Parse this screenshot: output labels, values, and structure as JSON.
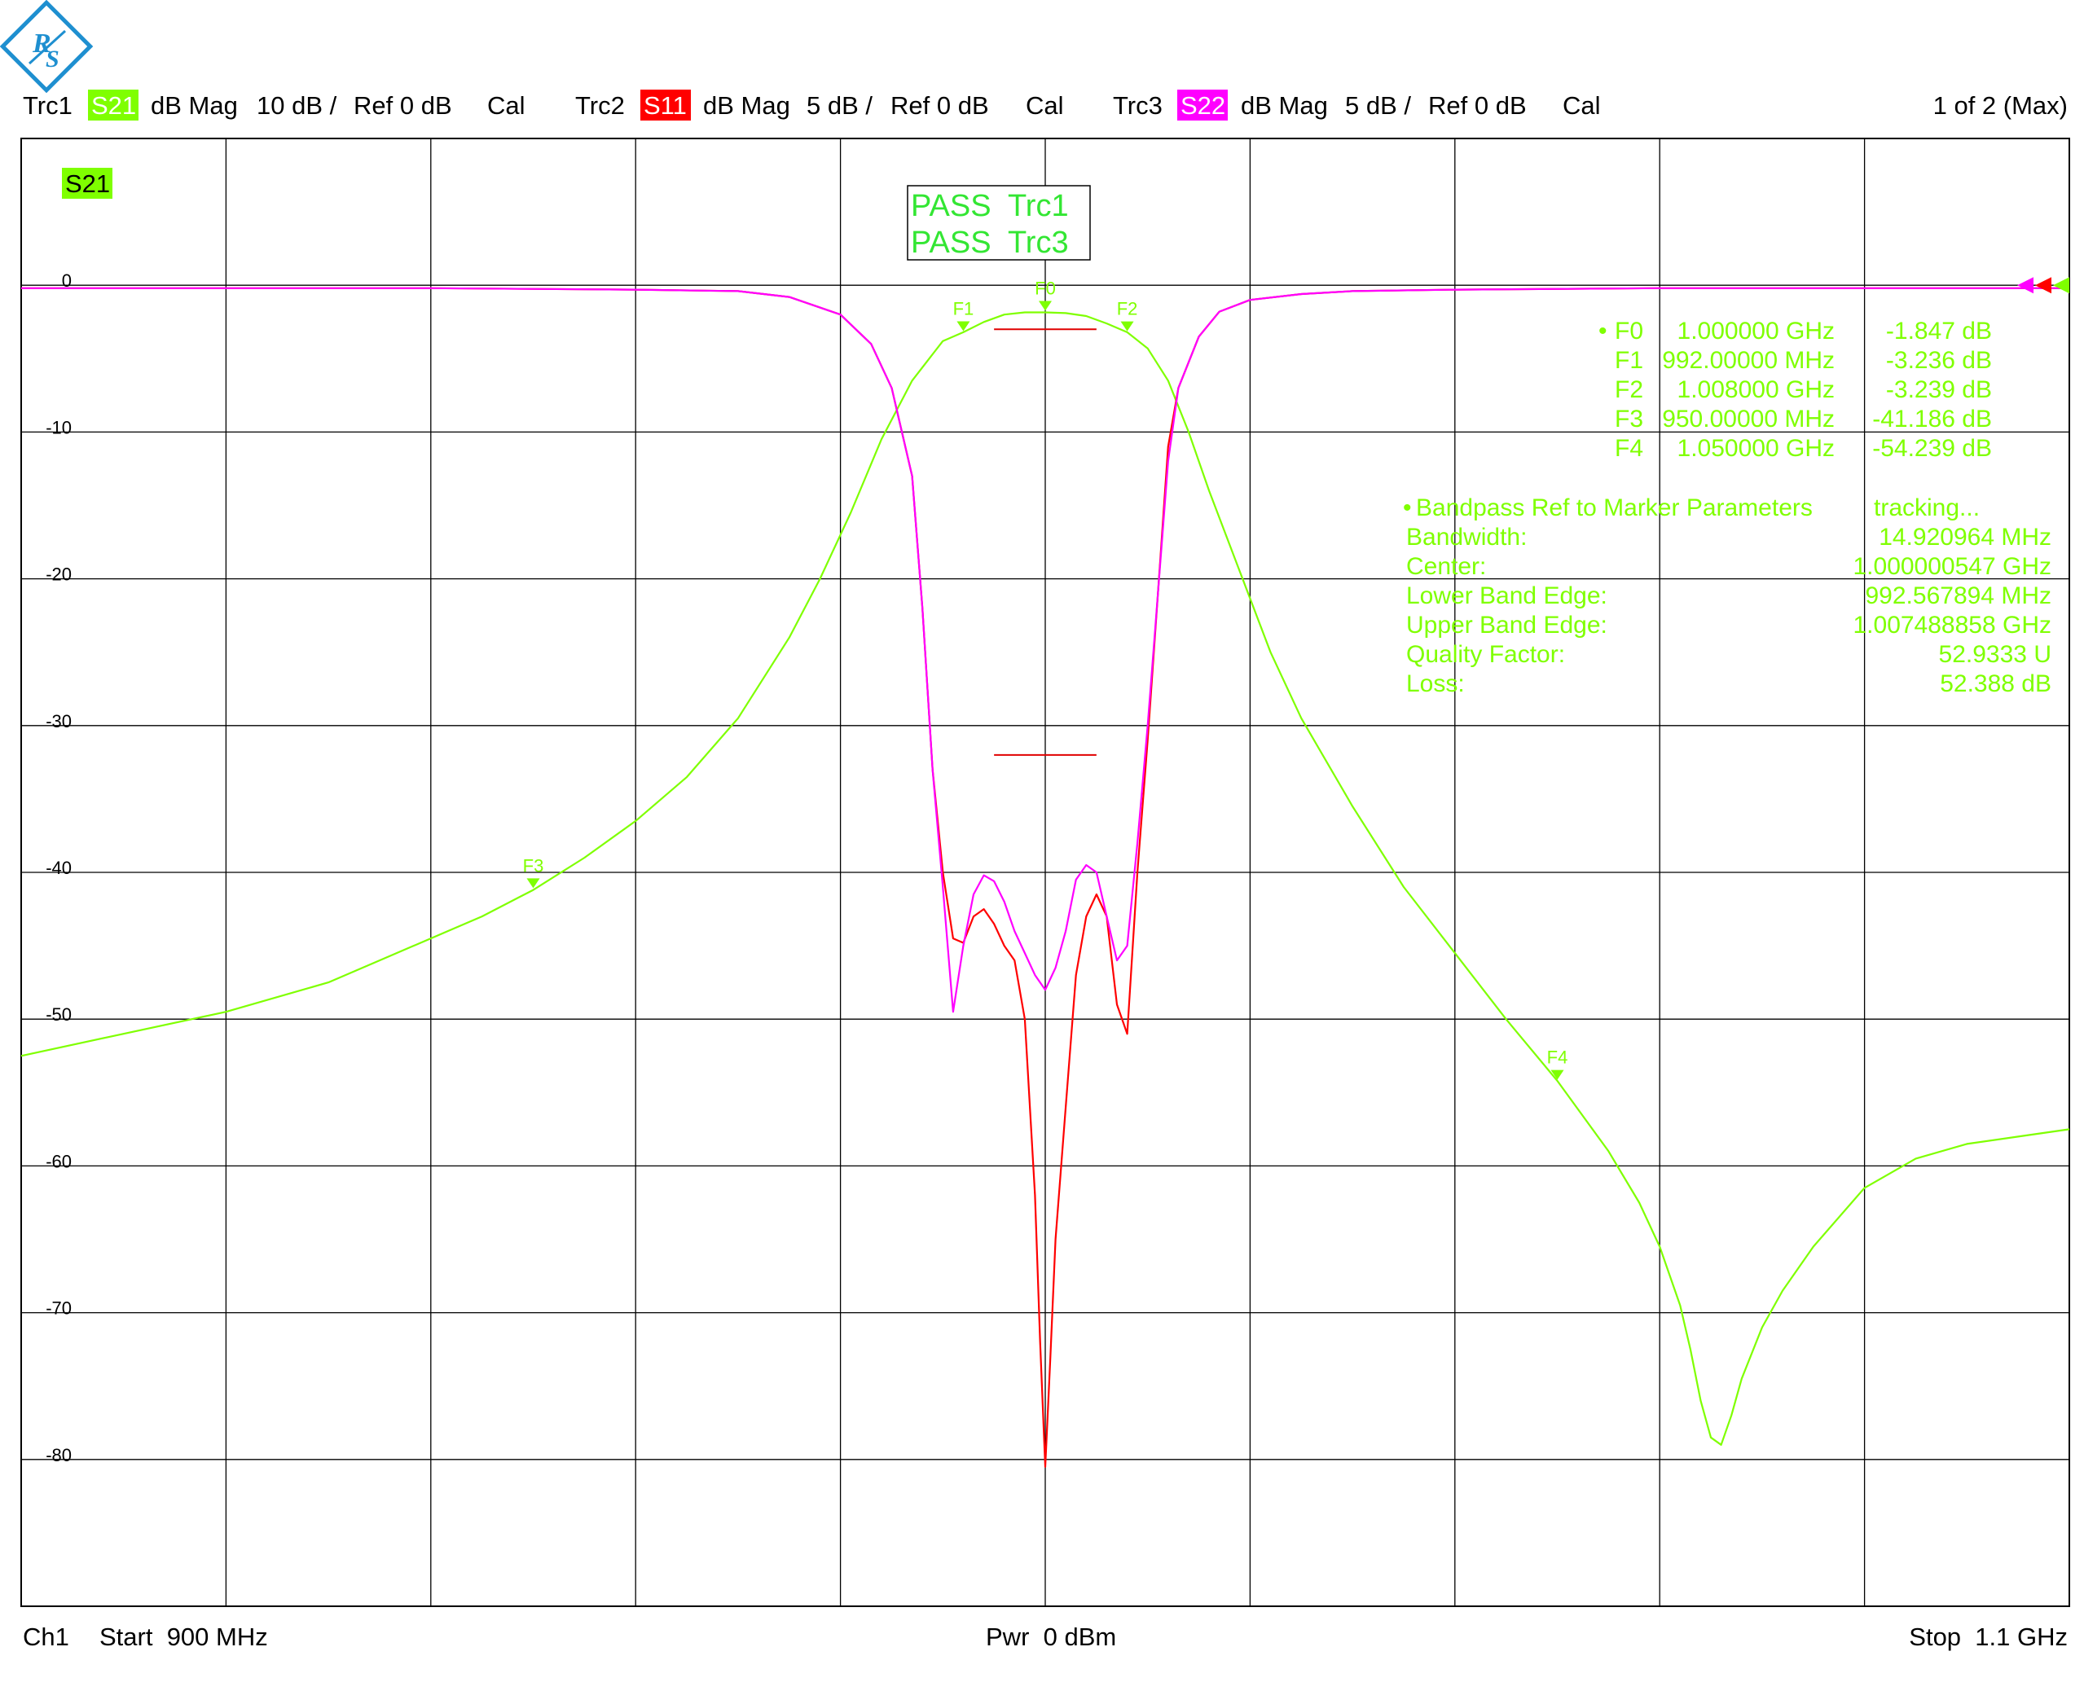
{
  "header": {
    "traces": [
      {
        "id": "Trc1",
        "param": "S21",
        "format": "dB Mag",
        "scale": "10 dB /",
        "ref": "Ref 0 dB",
        "cal": "Cal",
        "color": "#7fff00"
      },
      {
        "id": "Trc2",
        "param": "S11",
        "format": "dB Mag",
        "scale": "5 dB /",
        "ref": "Ref 0 dB",
        "cal": "Cal",
        "color": "#ff0000"
      },
      {
        "id": "Trc3",
        "param": "S22",
        "format": "dB Mag",
        "scale": "5 dB /",
        "ref": "Ref 0 dB",
        "cal": "Cal",
        "color": "#ff00ff"
      }
    ],
    "page_indicator": "1 of 2 (Max)"
  },
  "diagram": {
    "label": "S21",
    "pass": [
      "PASS  Trc1",
      "PASS  Trc3"
    ]
  },
  "marker_table": [
    {
      "name": "F0",
      "freq": "1.000000 GHz",
      "value": "-1.847 dB",
      "active": true
    },
    {
      "name": "F1",
      "freq": "992.00000 MHz",
      "value": "-3.236 dB",
      "active": false
    },
    {
      "name": "F2",
      "freq": "1.008000 GHz",
      "value": "-3.239 dB",
      "active": false
    },
    {
      "name": "F3",
      "freq": "950.00000 MHz",
      "value": "-41.186 dB",
      "active": false
    },
    {
      "name": "F4",
      "freq": "1.050000 GHz",
      "value": "-54.239 dB",
      "active": false
    }
  ],
  "bandpass": {
    "title": "Bandpass Ref to Marker Parameters",
    "status": "tracking...",
    "rows": [
      {
        "label": "Bandwidth:",
        "value": "14.920964 MHz"
      },
      {
        "label": "Center:",
        "value": "1.000000547 GHz"
      },
      {
        "label": "Lower Band Edge:",
        "value": "992.567894 MHz"
      },
      {
        "label": "Upper Band Edge:",
        "value": "1.007488858 GHz"
      },
      {
        "label": "Quality Factor:",
        "value": "52.9333 U"
      },
      {
        "label": "Loss:",
        "value": "52.388 dB"
      }
    ]
  },
  "footer": {
    "channel": "Ch1",
    "start": "Start  900 MHz",
    "power": "Pwr  0 dBm",
    "stop": "Stop  1.1 GHz"
  },
  "chart_data": {
    "type": "line",
    "title": "",
    "xlabel": "",
    "ylabel": "",
    "x_unit": "MHz",
    "xlim": [
      900,
      1100
    ],
    "ylim": [
      -90,
      10
    ],
    "y_tick_labels": [
      "0",
      "-10",
      "-20",
      "-30",
      "-40",
      "-50",
      "-60",
      "-70",
      "-80"
    ],
    "y_tick_values": [
      0,
      -10,
      -20,
      -30,
      -40,
      -50,
      -60,
      -70,
      -80
    ],
    "grid": true,
    "series": [
      {
        "name": "S21",
        "color": "#7fff00",
        "x": [
          900,
          910,
          920,
          930,
          935,
          940,
          945,
          950,
          955,
          960,
          965,
          970,
          975,
          978,
          981,
          984,
          987,
          990,
          992,
          994,
          996,
          998,
          1000,
          1002,
          1004,
          1006,
          1008,
          1010,
          1012,
          1014,
          1016,
          1019,
          1022,
          1025,
          1030,
          1035,
          1040,
          1045,
          1050,
          1055,
          1058,
          1060,
          1062,
          1063,
          1064,
          1065,
          1066,
          1067,
          1068,
          1070,
          1072,
          1075,
          1080,
          1085,
          1090,
          1095,
          1100
        ],
        "y": [
          -52.5,
          -51,
          -49.5,
          -47.5,
          -46,
          -44.5,
          -43,
          -41.2,
          -39,
          -36.5,
          -33.5,
          -29.5,
          -24,
          -20,
          -15.5,
          -10.5,
          -6.5,
          -3.8,
          -3.2,
          -2.5,
          -2,
          -1.85,
          -1.85,
          -1.9,
          -2.1,
          -2.6,
          -3.2,
          -4.3,
          -6.5,
          -10,
          -14,
          -19.5,
          -25,
          -29.5,
          -35.5,
          -41,
          -45.5,
          -50,
          -54.2,
          -59,
          -62.5,
          -65.5,
          -69.5,
          -72.5,
          -76,
          -78.5,
          -79,
          -77,
          -74.5,
          -71,
          -68.5,
          -65.5,
          -61.5,
          -59.5,
          -58.5,
          -58,
          -57.5
        ]
      },
      {
        "name": "S11",
        "color": "#ff0000",
        "x": [
          900,
          920,
          940,
          960,
          970,
          975,
          980,
          983,
          985,
          987,
          988,
          989,
          990,
          991,
          992,
          993,
          994,
          995,
          996,
          997,
          998,
          999,
          999.5,
          1000,
          1000.5,
          1001,
          1002,
          1003,
          1004,
          1005,
          1006,
          1007,
          1008,
          1009,
          1010,
          1011,
          1012,
          1013,
          1015,
          1017,
          1020,
          1025,
          1030,
          1040,
          1060,
          1080,
          1100
        ],
        "y": [
          -0.2,
          -0.2,
          -0.2,
          -0.3,
          -0.4,
          -0.8,
          -2,
          -4,
          -7,
          -13,
          -22,
          -33,
          -40,
          -44.5,
          -44.8,
          -43,
          -42.5,
          -43.5,
          -45,
          -46,
          -50,
          -62,
          -72,
          -80.5,
          -73,
          -65,
          -56,
          -47,
          -43,
          -41.5,
          -43,
          -49,
          -51,
          -40,
          -31,
          -21,
          -11,
          -7,
          -3.5,
          -1.8,
          -1,
          -0.6,
          -0.4,
          -0.3,
          -0.2,
          -0.2,
          -0.2
        ]
      },
      {
        "name": "S22",
        "color": "#ff00ff",
        "x": [
          900,
          920,
          940,
          960,
          970,
          975,
          980,
          983,
          985,
          987,
          988,
          989,
          990,
          991,
          992,
          993,
          994,
          995,
          996,
          997,
          998,
          999,
          1000,
          1001,
          1002,
          1003,
          1004,
          1005,
          1006,
          1007,
          1008,
          1009,
          1010,
          1011,
          1012,
          1013,
          1015,
          1017,
          1020,
          1025,
          1030,
          1040,
          1060,
          1080,
          1100
        ],
        "y": [
          -0.2,
          -0.2,
          -0.2,
          -0.3,
          -0.4,
          -0.8,
          -2,
          -4,
          -7,
          -13,
          -22,
          -33,
          -41,
          -49.5,
          -45,
          -41.5,
          -40.2,
          -40.6,
          -42,
          -44,
          -45.5,
          -47,
          -48,
          -46.5,
          -44,
          -40.5,
          -39.5,
          -40,
          -43,
          -46,
          -45,
          -38,
          -30,
          -21,
          -12,
          -7,
          -3.5,
          -1.8,
          -1,
          -0.6,
          -0.4,
          -0.3,
          -0.2,
          -0.2,
          -0.2
        ]
      }
    ],
    "limit_lines": [
      {
        "x": [
          995,
          1005
        ],
        "y": -3
      },
      {
        "x": [
          995,
          1005
        ],
        "y": -32
      }
    ],
    "markers": [
      {
        "name": "F0",
        "x": 1000,
        "y": -1.847
      },
      {
        "name": "F1",
        "x": 992,
        "y": -3.236
      },
      {
        "name": "F2",
        "x": 1008,
        "y": -3.239
      },
      {
        "name": "F3",
        "x": 950,
        "y": -41.186
      },
      {
        "name": "F4",
        "x": 1050,
        "y": -54.239
      }
    ]
  }
}
